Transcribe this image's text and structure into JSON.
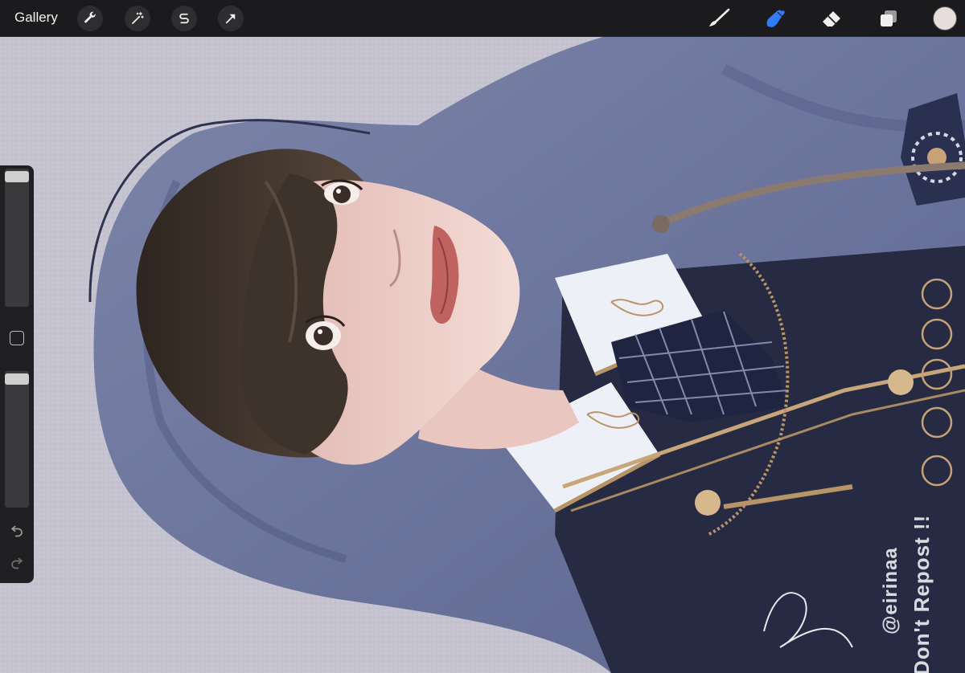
{
  "app": {
    "gallery_label": "Gallery"
  },
  "toolbar_left": [
    {
      "name": "actions",
      "icon": "wrench-icon"
    },
    {
      "name": "adjustments",
      "icon": "magic-wand-icon"
    },
    {
      "name": "selection",
      "icon": "selection-s-icon"
    },
    {
      "name": "transform",
      "icon": "arrow-cursor-icon"
    }
  ],
  "toolbar_right": [
    {
      "name": "brush",
      "icon": "brush-icon",
      "active": false
    },
    {
      "name": "smudge",
      "icon": "smudge-finger-icon",
      "active": true
    },
    {
      "name": "eraser",
      "icon": "eraser-icon",
      "active": false
    },
    {
      "name": "layers",
      "icon": "layers-icon",
      "active": false
    }
  ],
  "colors": {
    "active_tool": "#2f7cf6",
    "current_color": "#e8dcdc",
    "canvas_bg": "#c5c4d0",
    "hood": "#6a7298",
    "jacket": "#24283f",
    "hair": "#3b3129",
    "skin": "#f0d4cf",
    "gold": "#b89567"
  },
  "sidebar": {
    "brush_size": 0.98,
    "opacity": 0.98,
    "undo_icon": "undo-arrow-icon",
    "redo_icon": "redo-arrow-icon",
    "modify_icon": "square-modify-icon"
  },
  "watermark": {
    "handle": "@eirinaa",
    "notice": "Don't Repost !!"
  }
}
